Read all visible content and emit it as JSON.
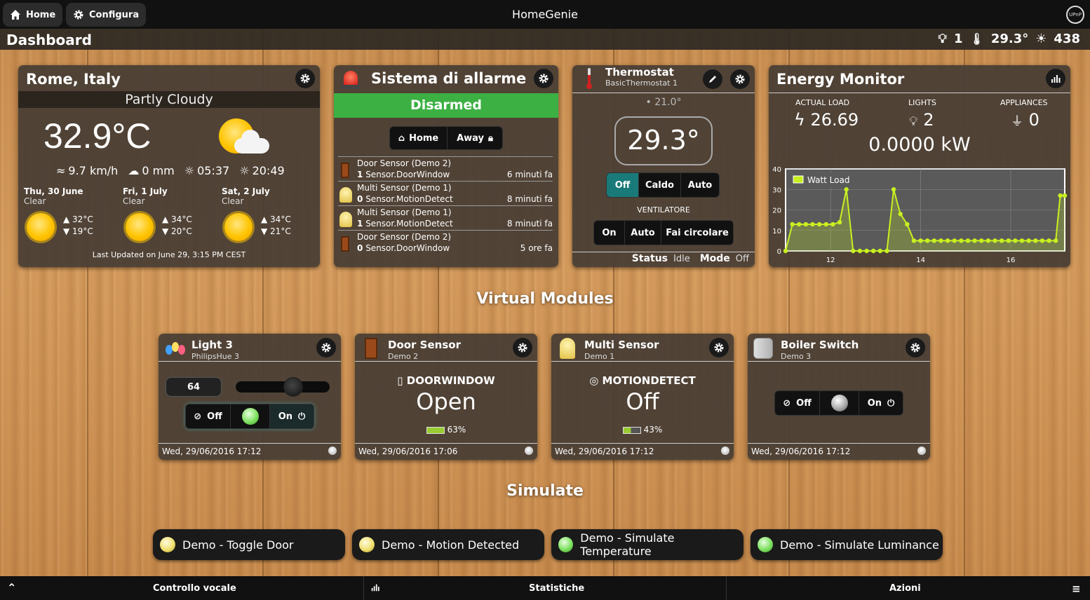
{
  "topbar": {
    "home_label": "Home",
    "config_label": "Configura",
    "app_title": "HomeGenie",
    "logo_text": "UPnP"
  },
  "subbar": {
    "title": "Dashboard",
    "lights": "1",
    "temperature": "29.3°",
    "luminance": "438"
  },
  "weather": {
    "location": "Rome, Italy",
    "condition": "Partly Cloudy",
    "temperature": "32.9°C",
    "wind": "9.7 km/h",
    "rain": "0 mm",
    "sunrise": "05:37",
    "sunset": "20:49",
    "forecast": [
      {
        "day": "Thu, 30 June",
        "cond": "Clear",
        "max": "▲ 32°C",
        "min": "▼ 19°C"
      },
      {
        "day": "Fri, 1 July",
        "cond": "Clear",
        "max": "▲ 34°C",
        "min": "▼ 20°C"
      },
      {
        "day": "Sat, 2 July",
        "cond": "Clear",
        "max": "▲ 34°C",
        "min": "▼ 21°C"
      }
    ],
    "updated": "Last Updated on June 29, 3:15 PM CEST"
  },
  "alarm": {
    "title": "Sistema di allarme",
    "status": "Disarmed",
    "status_color": "#3cb043",
    "home_label": "Home",
    "away_label": "Away",
    "events": [
      {
        "name": "Door Sensor (Demo 2)",
        "value": "1",
        "param": "Sensor.DoorWindow",
        "time": "6 minuti fa",
        "icon": "door-icon"
      },
      {
        "name": "Multi Sensor (Demo 1)",
        "value": "0",
        "param": "Sensor.MotionDetect",
        "time": "8 minuti fa",
        "icon": "multisensor-icon"
      },
      {
        "name": "Multi Sensor (Demo 1)",
        "value": "1",
        "param": "Sensor.MotionDetect",
        "time": "8 minuti fa",
        "icon": "multisensor-icon"
      },
      {
        "name": "Door Sensor (Demo 2)",
        "value": "0",
        "param": "Sensor.DoorWindow",
        "time": "5 ore fa",
        "icon": "door-icon"
      }
    ]
  },
  "thermostat": {
    "title": "Thermostat",
    "subtitle": "BasicThermostat 1",
    "setpoint": "21.0°",
    "current": "29.3°",
    "modes": [
      "Off",
      "Caldo",
      "Auto"
    ],
    "fan_label": "VENTILATORE",
    "fan_modes": [
      "On",
      "Auto",
      "Fai circolare"
    ],
    "status_label": "Status",
    "status_value": "Idle",
    "mode_label": "Mode",
    "mode_value": "Off"
  },
  "energy": {
    "title": "Energy Monitor",
    "actual_load_label": "ACTUAL LOAD",
    "actual_load": "26.69",
    "lights_label": "LIGHTS",
    "lights": "2",
    "appliances_label": "APPLIANCES",
    "appliances": "0",
    "kw": "0.0000 kW",
    "legend": "Watt Load",
    "series_color": "#c8f020"
  },
  "chart_data": {
    "type": "line",
    "series": [
      {
        "name": "Watt Load",
        "x": [
          11.0,
          11.15,
          11.3,
          11.45,
          11.6,
          11.75,
          11.9,
          12.05,
          12.2,
          12.35,
          12.5,
          12.65,
          12.8,
          12.95,
          13.1,
          13.25,
          13.4,
          13.55,
          13.7,
          13.85,
          14.0,
          14.15,
          14.3,
          14.45,
          14.6,
          14.75,
          14.9,
          15.05,
          15.2,
          15.35,
          15.5,
          15.65,
          15.8,
          15.95,
          16.1,
          16.25,
          16.4,
          16.55,
          16.7,
          16.85,
          17.0,
          17.1,
          17.2
        ],
        "values": [
          0,
          13,
          13,
          13,
          13,
          13,
          13,
          13,
          14,
          30,
          0,
          0,
          0,
          0,
          0,
          0,
          30,
          18,
          13,
          5,
          5,
          5,
          5,
          5,
          5,
          5,
          5,
          5,
          5,
          5,
          5,
          5,
          5,
          5,
          5,
          5,
          5,
          5,
          5,
          5,
          5,
          27,
          27
        ]
      }
    ],
    "xticks": [
      "12",
      "14",
      "16"
    ],
    "yticks": [
      "0",
      "10",
      "20",
      "30",
      "40"
    ],
    "xlim": [
      11,
      17.2
    ],
    "ylim": [
      0,
      40
    ]
  },
  "sections": {
    "virtual_modules": "Virtual Modules",
    "simulate": "Simulate"
  },
  "modules": [
    {
      "title": "Light 3",
      "subtitle": "PhilipsHue 3",
      "level": "64",
      "level_fraction": 0.64,
      "off": "Off",
      "on": "On",
      "timestamp": "Wed, 29/06/2016 17:12"
    },
    {
      "title": "Door Sensor",
      "subtitle": "Demo 2",
      "field": "DOORWINDOW",
      "value": "Open",
      "battery": "63%",
      "timestamp": "Wed, 29/06/2016 17:06"
    },
    {
      "title": "Multi Sensor",
      "subtitle": "Demo 1",
      "field": "MOTIONDETECT",
      "value": "Off",
      "battery": "43%",
      "timestamp": "Wed, 29/06/2016 17:12"
    },
    {
      "title": "Boiler Switch",
      "subtitle": "Demo 3",
      "off": "Off",
      "on": "On",
      "timestamp": "Wed, 29/06/2016 17:12"
    }
  ],
  "simulate": [
    {
      "label": "Demo - Toggle Door",
      "led": "yellow"
    },
    {
      "label": "Demo - Motion Detected",
      "led": "yellow"
    },
    {
      "label": "Demo - Simulate Temperature",
      "led": "green"
    },
    {
      "label": "Demo - Simulate Luminance",
      "led": "green"
    }
  ],
  "bottombar": {
    "voice": "Controllo vocale",
    "stats": "Statistiche",
    "actions": "Azioni"
  }
}
